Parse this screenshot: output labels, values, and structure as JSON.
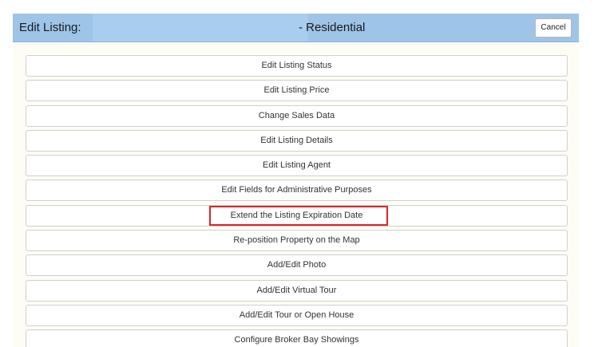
{
  "header": {
    "title": "Edit Listing:",
    "property_type": "- Residential",
    "cancel_label": "Cancel"
  },
  "menu": {
    "items": [
      {
        "label": "Edit Listing Status"
      },
      {
        "label": "Edit Listing Price"
      },
      {
        "label": "Change Sales Data"
      },
      {
        "label": "Edit Listing Details"
      },
      {
        "label": "Edit Listing Agent"
      },
      {
        "label": "Edit Fields for Administrative Purposes"
      },
      {
        "label": "Extend the Listing Expiration Date",
        "highlighted": true
      },
      {
        "label": "Re-position Property on the Map"
      },
      {
        "label": "Add/Edit Photo"
      },
      {
        "label": "Add/Edit Virtual Tour"
      },
      {
        "label": "Add/Edit Tour or Open House"
      },
      {
        "label": "Configure Broker Bay Showings"
      }
    ]
  },
  "colors": {
    "header_bg": "#9ec4e8",
    "panel_bg": "#fefdf5",
    "highlight": "#d9262b"
  }
}
